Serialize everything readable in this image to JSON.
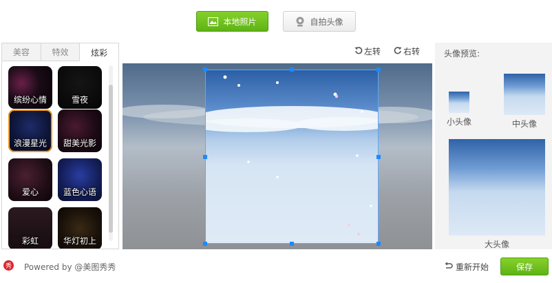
{
  "toolbar": {
    "local_photo_label": "本地照片",
    "selfie_label": "自拍头像"
  },
  "tabs": [
    {
      "label": "美容",
      "active": false
    },
    {
      "label": "特效",
      "active": false
    },
    {
      "label": "炫彩",
      "active": true
    }
  ],
  "effects": [
    {
      "label": "缤纷心情",
      "selected": false
    },
    {
      "label": "雪夜",
      "selected": false
    },
    {
      "label": "浪漫星光",
      "selected": true
    },
    {
      "label": "甜美光影",
      "selected": false
    },
    {
      "label": "爱心",
      "selected": false
    },
    {
      "label": "蓝色心语",
      "selected": false
    },
    {
      "label": "彩虹",
      "selected": false
    },
    {
      "label": "华灯初上",
      "selected": false
    }
  ],
  "rotate": {
    "left_label": "左转",
    "right_label": "右转"
  },
  "preview": {
    "title": "头像预览:",
    "small_label": "小头像",
    "medium_label": "中头像",
    "large_label": "大头像"
  },
  "footer": {
    "logo_text": "秀",
    "powered_by": "Powered by @美图秀秀",
    "reset_label": "重新开始",
    "save_label": "保存"
  },
  "colors": {
    "accent_green": "#5fb315",
    "selection_orange": "#f29a1f",
    "crop_handle_blue": "#1e88ff"
  }
}
